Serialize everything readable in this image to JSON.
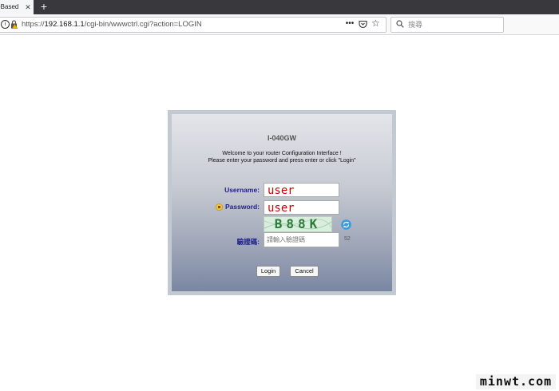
{
  "browser": {
    "tab": {
      "title": "-Based"
    },
    "url": {
      "host": "192.168.1.1",
      "path": "/cgi-bin/wwwctrl.cgi?action=LOGIN",
      "scheme": "https://"
    },
    "search": {
      "placeholder": "搜尋"
    },
    "icons": [
      "info-icon",
      "lock-warning-icon",
      "more-dots-icon",
      "pocket-icon",
      "star-icon",
      "search-icon",
      "close-icon",
      "plus-icon"
    ]
  },
  "login": {
    "device_title": "I-040GW",
    "welcome_line1": "Welcome to your router Configuration Interface !",
    "welcome_line2": "Please enter your password and press enter or click \"Login\"",
    "username_label": "Username:",
    "username_value": "user",
    "password_label": "Password:",
    "password_value": "user",
    "captcha_text": "B88K",
    "code_label": "驗證碼:",
    "code_placeholder": "請輸入驗證碼",
    "code_number": "52",
    "login_button": "Login",
    "cancel_button": "Cancel",
    "accent_color": "#1e1e8c",
    "input_text_color": "#d40000"
  },
  "watermark": {
    "text": "minwt.com"
  }
}
